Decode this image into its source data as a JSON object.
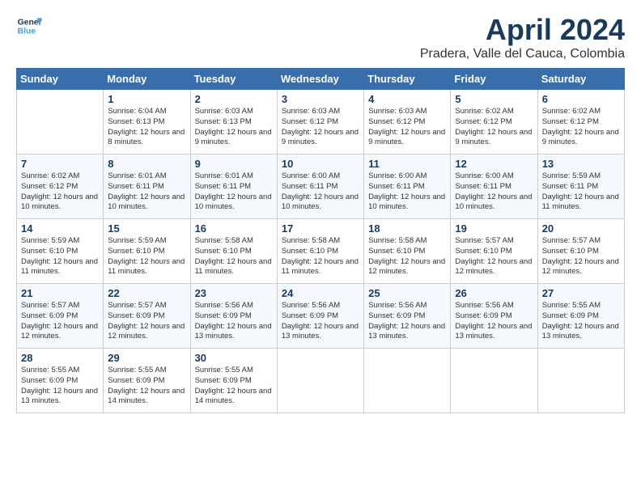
{
  "header": {
    "logo_line1": "General",
    "logo_line2": "Blue",
    "month": "April 2024",
    "location": "Pradera, Valle del Cauca, Colombia"
  },
  "weekdays": [
    "Sunday",
    "Monday",
    "Tuesday",
    "Wednesday",
    "Thursday",
    "Friday",
    "Saturday"
  ],
  "weeks": [
    [
      {
        "day": null
      },
      {
        "day": 1,
        "sunrise": "6:04 AM",
        "sunset": "6:13 PM",
        "daylight": "12 hours and 8 minutes."
      },
      {
        "day": 2,
        "sunrise": "6:03 AM",
        "sunset": "6:13 PM",
        "daylight": "12 hours and 9 minutes."
      },
      {
        "day": 3,
        "sunrise": "6:03 AM",
        "sunset": "6:12 PM",
        "daylight": "12 hours and 9 minutes."
      },
      {
        "day": 4,
        "sunrise": "6:03 AM",
        "sunset": "6:12 PM",
        "daylight": "12 hours and 9 minutes."
      },
      {
        "day": 5,
        "sunrise": "6:02 AM",
        "sunset": "6:12 PM",
        "daylight": "12 hours and 9 minutes."
      },
      {
        "day": 6,
        "sunrise": "6:02 AM",
        "sunset": "6:12 PM",
        "daylight": "12 hours and 9 minutes."
      }
    ],
    [
      {
        "day": 7,
        "sunrise": "6:02 AM",
        "sunset": "6:12 PM",
        "daylight": "12 hours and 10 minutes."
      },
      {
        "day": 8,
        "sunrise": "6:01 AM",
        "sunset": "6:11 PM",
        "daylight": "12 hours and 10 minutes."
      },
      {
        "day": 9,
        "sunrise": "6:01 AM",
        "sunset": "6:11 PM",
        "daylight": "12 hours and 10 minutes."
      },
      {
        "day": 10,
        "sunrise": "6:00 AM",
        "sunset": "6:11 PM",
        "daylight": "12 hours and 10 minutes."
      },
      {
        "day": 11,
        "sunrise": "6:00 AM",
        "sunset": "6:11 PM",
        "daylight": "12 hours and 10 minutes."
      },
      {
        "day": 12,
        "sunrise": "6:00 AM",
        "sunset": "6:11 PM",
        "daylight": "12 hours and 10 minutes."
      },
      {
        "day": 13,
        "sunrise": "5:59 AM",
        "sunset": "6:11 PM",
        "daylight": "12 hours and 11 minutes."
      }
    ],
    [
      {
        "day": 14,
        "sunrise": "5:59 AM",
        "sunset": "6:10 PM",
        "daylight": "12 hours and 11 minutes."
      },
      {
        "day": 15,
        "sunrise": "5:59 AM",
        "sunset": "6:10 PM",
        "daylight": "12 hours and 11 minutes."
      },
      {
        "day": 16,
        "sunrise": "5:58 AM",
        "sunset": "6:10 PM",
        "daylight": "12 hours and 11 minutes."
      },
      {
        "day": 17,
        "sunrise": "5:58 AM",
        "sunset": "6:10 PM",
        "daylight": "12 hours and 11 minutes."
      },
      {
        "day": 18,
        "sunrise": "5:58 AM",
        "sunset": "6:10 PM",
        "daylight": "12 hours and 12 minutes."
      },
      {
        "day": 19,
        "sunrise": "5:57 AM",
        "sunset": "6:10 PM",
        "daylight": "12 hours and 12 minutes."
      },
      {
        "day": 20,
        "sunrise": "5:57 AM",
        "sunset": "6:10 PM",
        "daylight": "12 hours and 12 minutes."
      }
    ],
    [
      {
        "day": 21,
        "sunrise": "5:57 AM",
        "sunset": "6:09 PM",
        "daylight": "12 hours and 12 minutes."
      },
      {
        "day": 22,
        "sunrise": "5:57 AM",
        "sunset": "6:09 PM",
        "daylight": "12 hours and 12 minutes."
      },
      {
        "day": 23,
        "sunrise": "5:56 AM",
        "sunset": "6:09 PM",
        "daylight": "12 hours and 13 minutes."
      },
      {
        "day": 24,
        "sunrise": "5:56 AM",
        "sunset": "6:09 PM",
        "daylight": "12 hours and 13 minutes."
      },
      {
        "day": 25,
        "sunrise": "5:56 AM",
        "sunset": "6:09 PM",
        "daylight": "12 hours and 13 minutes."
      },
      {
        "day": 26,
        "sunrise": "5:56 AM",
        "sunset": "6:09 PM",
        "daylight": "12 hours and 13 minutes."
      },
      {
        "day": 27,
        "sunrise": "5:55 AM",
        "sunset": "6:09 PM",
        "daylight": "12 hours and 13 minutes."
      }
    ],
    [
      {
        "day": 28,
        "sunrise": "5:55 AM",
        "sunset": "6:09 PM",
        "daylight": "12 hours and 13 minutes."
      },
      {
        "day": 29,
        "sunrise": "5:55 AM",
        "sunset": "6:09 PM",
        "daylight": "12 hours and 14 minutes."
      },
      {
        "day": 30,
        "sunrise": "5:55 AM",
        "sunset": "6:09 PM",
        "daylight": "12 hours and 14 minutes."
      },
      {
        "day": null
      },
      {
        "day": null
      },
      {
        "day": null
      },
      {
        "day": null
      }
    ]
  ]
}
